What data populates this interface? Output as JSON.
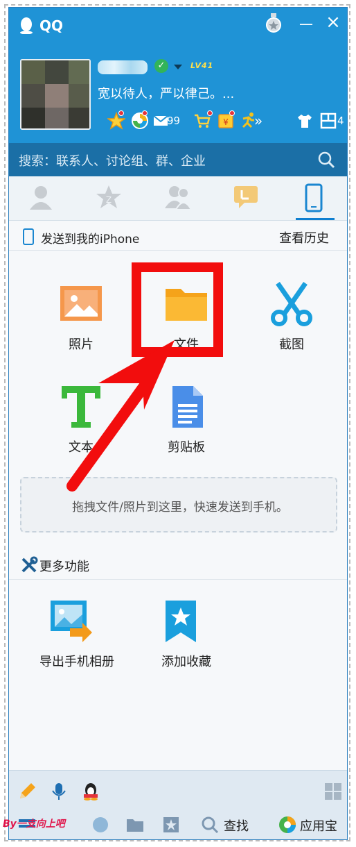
{
  "app": {
    "title": "QQ",
    "level_badge": "LV41",
    "signature": "宽以待人，严以律己。...",
    "mail_count": "99",
    "skin_count": "4"
  },
  "search": {
    "placeholder": "搜索：联系人、讨论组、群、企业"
  },
  "tabs": [
    "contacts-icon",
    "favorites-icon",
    "groups-icon",
    "messages-icon",
    "phone-icon"
  ],
  "send": {
    "title": "发送到我的iPhone",
    "history_label": "查看历史",
    "tools": [
      {
        "label": "照片",
        "icon": "photo-icon"
      },
      {
        "label": "文件",
        "icon": "folder-icon"
      },
      {
        "label": "截图",
        "icon": "scissors-icon"
      },
      {
        "label": "文本",
        "icon": "text-icon"
      },
      {
        "label": "剪贴板",
        "icon": "clipboard-icon"
      }
    ],
    "drop_text": "拖拽文件/照片到这里，快速发送到手机。"
  },
  "more": {
    "title": "更多功能",
    "tools": [
      {
        "label": "导出手机相册",
        "icon": "export-album-icon"
      },
      {
        "label": "添加收藏",
        "icon": "bookmark-icon"
      }
    ]
  },
  "bottom": {
    "find_label": "查找",
    "app_label": "应用宝"
  },
  "watermark": "By一支向上吧",
  "colors": {
    "header": "#1f93d6",
    "search_bar": "#1b6fa6",
    "highlight": "#f20d0d",
    "accent": "#0f7fd0",
    "orange": "#f5a31a"
  }
}
